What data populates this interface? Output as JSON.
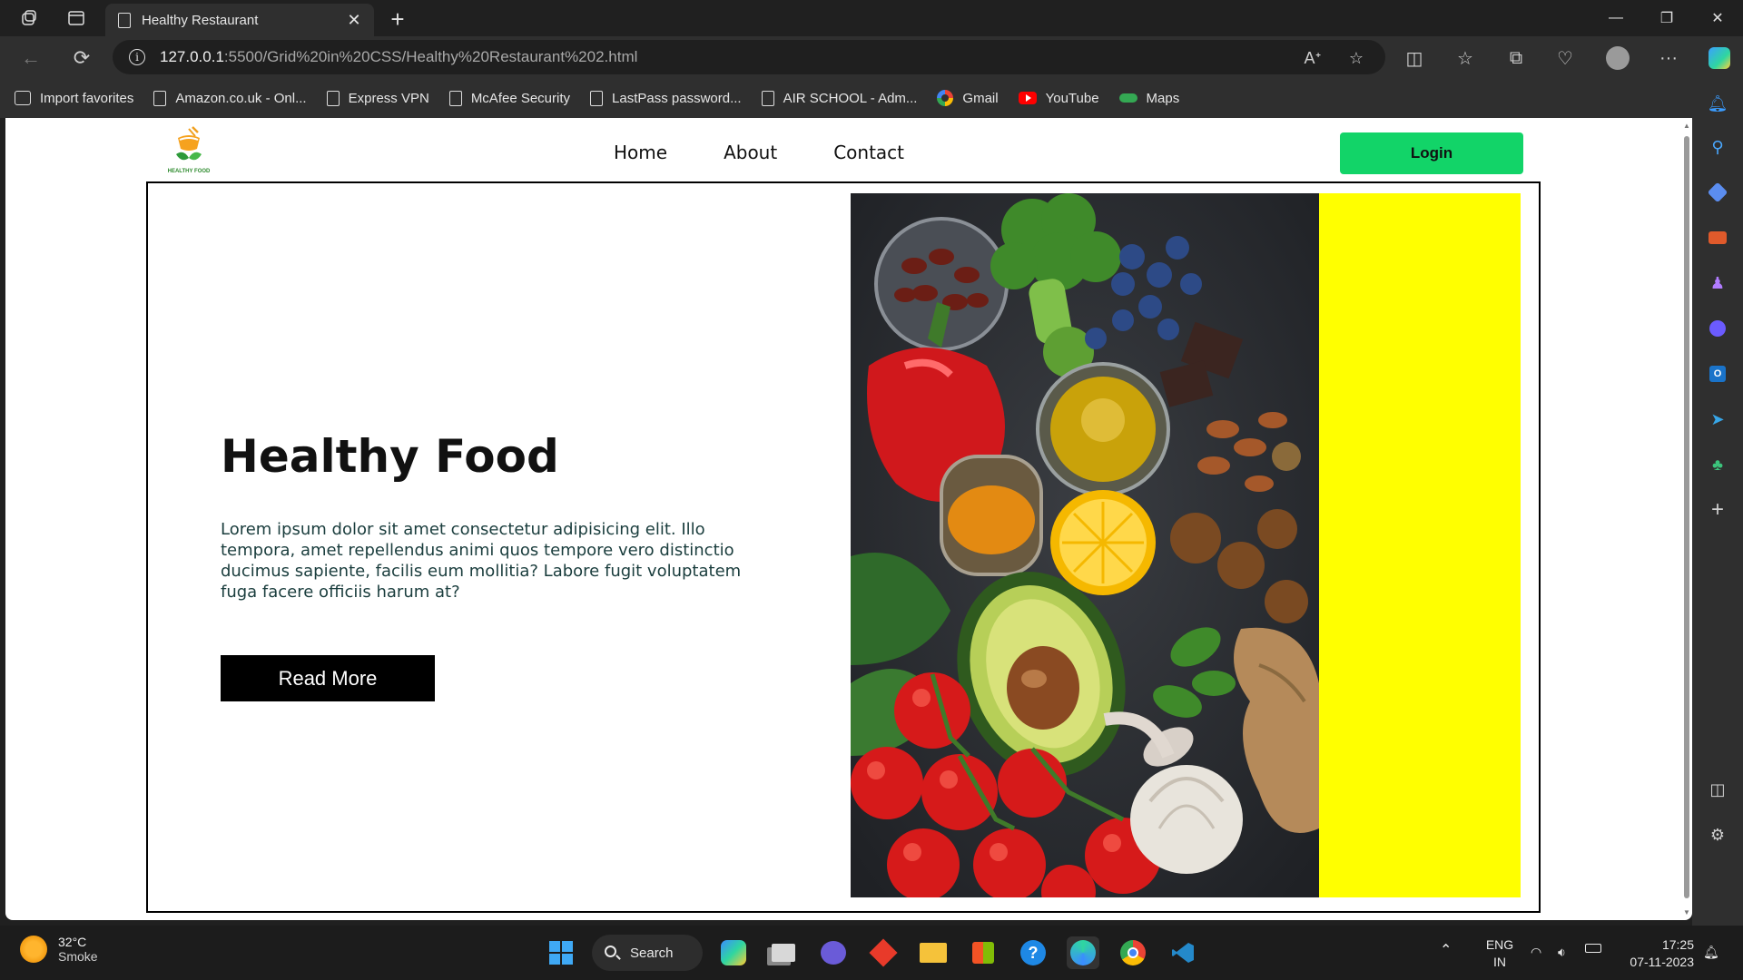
{
  "browser": {
    "tab_title": "Healthy Restaurant",
    "url_host": "127.0.0.1",
    "url_path": ":5500/Grid%20in%20CSS/Healthy%20Restaurant%202.html",
    "favorites": [
      {
        "label": "Import favorites",
        "icon": "import-icon"
      },
      {
        "label": "Amazon.co.uk - Onl...",
        "icon": "page-icon"
      },
      {
        "label": "Express VPN",
        "icon": "page-icon"
      },
      {
        "label": "McAfee Security",
        "icon": "page-icon"
      },
      {
        "label": "LastPass password...",
        "icon": "page-icon"
      },
      {
        "label": "AIR SCHOOL - Adm...",
        "icon": "page-icon"
      },
      {
        "label": "Gmail",
        "icon": "google-icon"
      },
      {
        "label": "YouTube",
        "icon": "youtube-icon"
      },
      {
        "label": "Maps",
        "icon": "maps-icon"
      }
    ]
  },
  "site": {
    "logo_text": "HEALTHY FOOD",
    "nav": {
      "home": "Home",
      "about": "About",
      "contact": "Contact"
    },
    "login": "Login",
    "hero": {
      "title": "Healthy Food",
      "text": "Lorem ipsum dolor sit amet consectetur adipisicing elit. Illo tempora, amet repellendus animi quos tempore vero distinctio ducimus sapiente, facilis eum mollitia? Labore fugit voluptatem fuga facere officiis harum at?",
      "button": "Read More"
    },
    "colors": {
      "login_bg": "#12d468",
      "panel": "#ffff00",
      "button_bg": "#000000"
    }
  },
  "taskbar": {
    "weather_temp": "32°C",
    "weather_cond": "Smoke",
    "search": "Search",
    "lang": "ENG",
    "region": "IN",
    "time": "17:25",
    "date": "07-11-2023"
  }
}
